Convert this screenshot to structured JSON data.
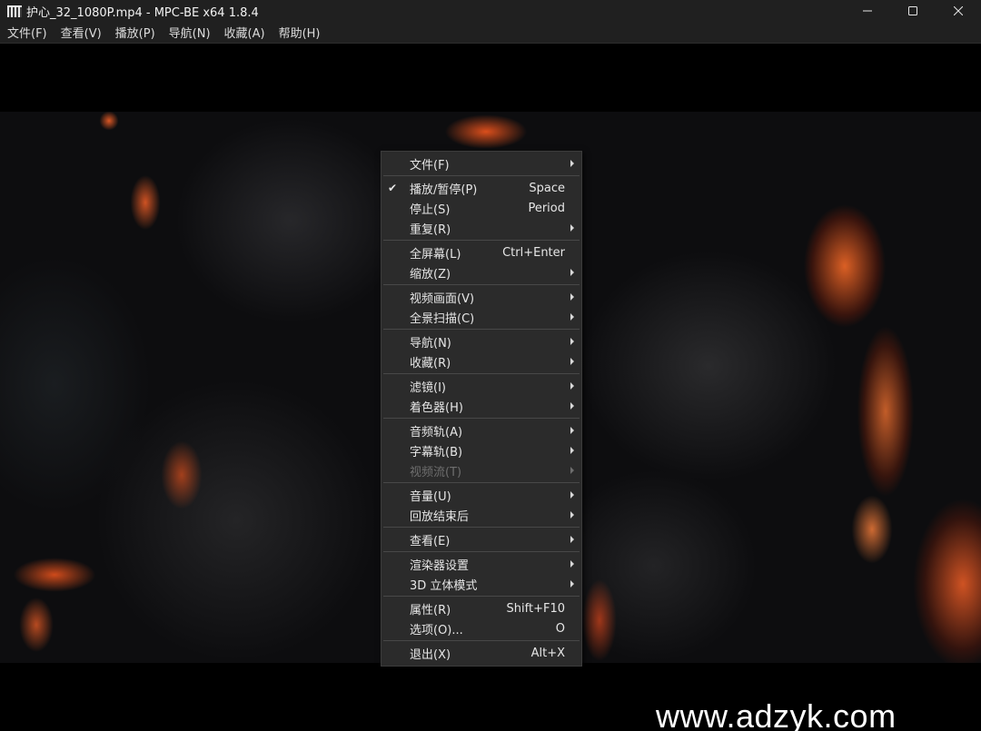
{
  "window": {
    "title": "护心_32_1080P.mp4 - MPC-BE x64 1.8.4",
    "app_icon": "film-clapper-icon",
    "controls": {
      "minimize_icon": "minimize-icon",
      "maximize_icon": "maximize-icon",
      "close_icon": "close-icon"
    }
  },
  "menubar": {
    "items": [
      {
        "label": "文件(F)"
      },
      {
        "label": "查看(V)"
      },
      {
        "label": "播放(P)"
      },
      {
        "label": "导航(N)"
      },
      {
        "label": "收藏(A)"
      },
      {
        "label": "帮助(H)"
      }
    ]
  },
  "context_menu": {
    "groups": [
      [
        {
          "label": "文件(F)",
          "submenu": true
        }
      ],
      [
        {
          "label": "播放/暂停(P)",
          "shortcut": "Space",
          "checked": true
        },
        {
          "label": "停止(S)",
          "shortcut": "Period"
        },
        {
          "label": "重复(R)",
          "submenu": true
        }
      ],
      [
        {
          "label": "全屏幕(L)",
          "shortcut": "Ctrl+Enter"
        },
        {
          "label": "缩放(Z)",
          "submenu": true
        }
      ],
      [
        {
          "label": "视频画面(V)",
          "submenu": true
        },
        {
          "label": "全景扫描(C)",
          "submenu": true
        }
      ],
      [
        {
          "label": "导航(N)",
          "submenu": true
        },
        {
          "label": "收藏(R)",
          "submenu": true
        }
      ],
      [
        {
          "label": "滤镜(I)",
          "submenu": true
        },
        {
          "label": "着色器(H)",
          "submenu": true
        }
      ],
      [
        {
          "label": "音频轨(A)",
          "submenu": true
        },
        {
          "label": "字幕轨(B)",
          "submenu": true
        },
        {
          "label": "视频流(T)",
          "submenu": true,
          "disabled": true
        }
      ],
      [
        {
          "label": "音量(U)",
          "submenu": true
        },
        {
          "label": "回放结束后",
          "submenu": true
        }
      ],
      [
        {
          "label": "查看(E)",
          "submenu": true
        }
      ],
      [
        {
          "label": "渲染器设置",
          "submenu": true
        },
        {
          "label": "3D 立体模式",
          "submenu": true
        }
      ],
      [
        {
          "label": "属性(R)",
          "shortcut": "Shift+F10"
        },
        {
          "label": "选项(O)...",
          "shortcut": "O"
        }
      ],
      [
        {
          "label": "退出(X)",
          "shortcut": "Alt+X"
        }
      ]
    ]
  },
  "watermark": {
    "text": "www.adzyk.com"
  },
  "colors": {
    "titlebar_bg": "#202020",
    "menu_bg": "#2b2b2b",
    "menu_text": "#e6e6e6",
    "menu_disabled_text": "#6e6e6e",
    "lava_accent": "#ff6e28"
  }
}
